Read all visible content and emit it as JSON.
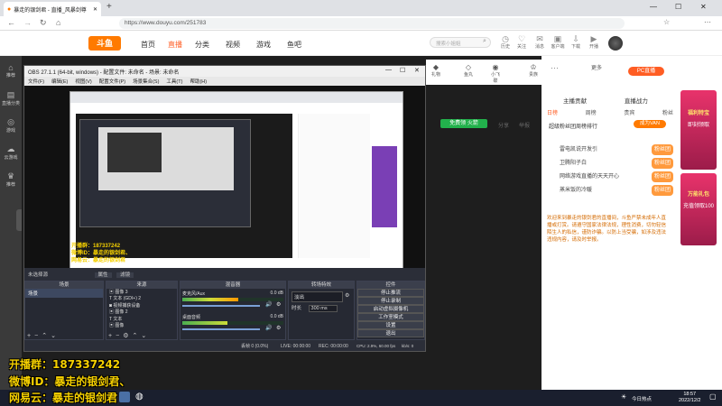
{
  "browser": {
    "tab_title": "暴走的银剑君 - 直播_风暴剑尊",
    "url": "https://www.douyu.com/251783",
    "new_tab": "+"
  },
  "site": {
    "logo": "斗鱼",
    "nav": [
      "首页",
      "直播",
      "分类",
      "视频",
      "游戏",
      "鱼吧"
    ],
    "search_placeholder": "搜索小姐姐",
    "header_icons": [
      {
        "icon": "history-icon",
        "label": "历史"
      },
      {
        "icon": "follow-icon",
        "label": "关注"
      },
      {
        "icon": "message-icon",
        "label": "消息"
      },
      {
        "icon": "recharge-icon",
        "label": "客户端"
      },
      {
        "icon": "download-icon",
        "label": "下载"
      },
      {
        "icon": "open-live-icon",
        "label": "开播"
      }
    ]
  },
  "left_sidebar": [
    {
      "icon": "home-icon",
      "label": "推荐"
    },
    {
      "icon": "live-icon",
      "label": "直播分类"
    },
    {
      "icon": "game-icon",
      "label": "游戏"
    },
    {
      "icon": "cloud-icon",
      "label": "云游戏"
    },
    {
      "icon": "rank-icon",
      "label": "推荐"
    }
  ],
  "room_bar": {
    "items": [
      "礼物",
      "鱼丸",
      "粉丝团",
      "直播节目",
      "贵族",
      "小飞碟",
      "更多"
    ],
    "pc_live": "PC直播",
    "free_gift": "免费领 火箭",
    "share": "分享",
    "report": "举报",
    "follow_count": "关注"
  },
  "right_panel": {
    "header": "主播贡献",
    "header2": "直播战力",
    "tabs": [
      "日榜",
      "周榜",
      "贵宾",
      "粉丝"
    ],
    "rank_title": "超级粉丝团周榜排行",
    "rank_button": "成为VAN",
    "ranks": [
      {
        "name": "雷电凯说开发引",
        "badge": "粉丝团"
      },
      {
        "name": "卫腾阳子白",
        "badge": "粉丝团"
      },
      {
        "name": "网络游戏直播的天天开心",
        "badge": "粉丝团"
      },
      {
        "name": "蒸米饭的冷暖",
        "badge": "粉丝团"
      }
    ],
    "notice": "欢迎来到暴走的银剑君的直播间，斗鱼严禁未成年人直播或打赏。请遵守国家法律法规，理性消费，切勿轻信陌生人的私信，谨防诈骗。以防上当受骗，如涉及违法违规内容，请及时举报。",
    "ads": [
      {
        "title": "福利特宝",
        "sub": "即刻领取"
      },
      {
        "title": "万能礼包",
        "sub": "充值领取100"
      }
    ]
  },
  "obs": {
    "title": "OBS 27.1.1 (64-bit, windows) - 配置文件: 未命名 - 场景: 未命名",
    "menu": [
      "文件(F)",
      "编辑(E)",
      "视图(V)",
      "配置文件(P)",
      "场景集合(S)",
      "工具(T)",
      "帮助(H)"
    ],
    "no_source": "未选择源",
    "properties": "属性",
    "filters": "滤镜",
    "panels": {
      "scenes": "场景",
      "sources": "来源",
      "mixer": "混音器",
      "transitions": "转场特效",
      "controls": "控件"
    },
    "scene_items": [
      "场景"
    ],
    "source_items": [
      "图像 3",
      "文本 (GDI+) 2",
      "视频捕获设备",
      "图像 2",
      "文本",
      "图像"
    ],
    "mixer_tracks": [
      {
        "name": "麦克风/Aux",
        "db": "0.0 dB",
        "level": 0.55
      },
      {
        "name": "桌面音频",
        "db": "0.0 dB",
        "level": 0.45
      }
    ],
    "transition_type": "淡出",
    "duration_label": "时长",
    "duration_value": "300 ms",
    "control_buttons": [
      "停止推流",
      "停止录制",
      "启动虚拟摄像机",
      "工作室模式",
      "设置",
      "退出"
    ],
    "status": {
      "dropped": "丢帧 0 (0.0%)",
      "live": "LIVE: 00:00:00",
      "rec": "REC: 00:00:00",
      "cpu": "CPU: 2.9%, 60.00 fps",
      "kbps": "kb/s: 0"
    }
  },
  "overlay": {
    "qq_group": "开播群：187337242",
    "weibo": "微博ID：暴走的银剑君、",
    "netease": "网易云：暴走的银剑君",
    "preview_lines": [
      "开播群：187337242",
      "微博ID：暴走的银剑君、",
      "网易云：暴走的银剑君"
    ]
  },
  "taskbar": {
    "weather": "今日热点",
    "time": "18:57",
    "date": "2022/12/2"
  },
  "colors": {
    "brand_orange": "#ff5d23",
    "overlay_yellow": "#f5d000",
    "gift_red": "#e8336b",
    "free_green": "#22b14c"
  }
}
